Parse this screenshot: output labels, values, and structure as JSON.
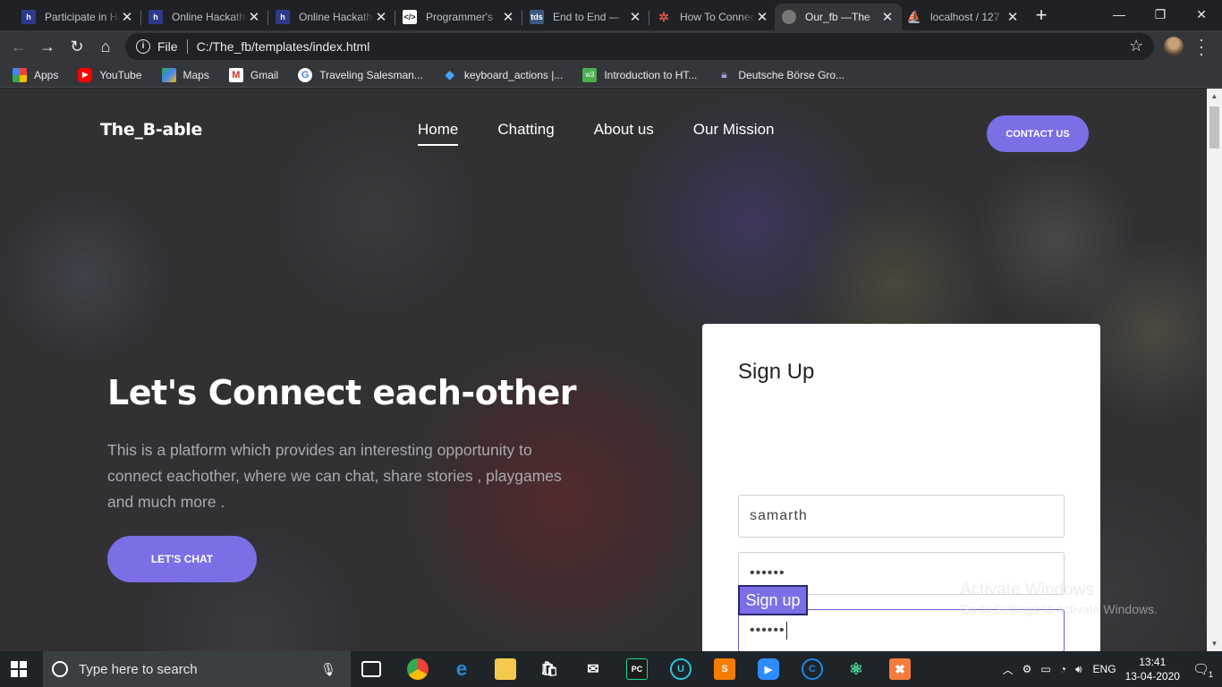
{
  "browser": {
    "tabs": [
      {
        "title": "Participate in HackerEarth",
        "favicon": "hackerearth-icon",
        "color": "#2d3a8c"
      },
      {
        "title": "Online Hackathons",
        "favicon": "hackerearth-icon",
        "color": "#2d3a8c"
      },
      {
        "title": "Online Hackathons",
        "favicon": "hackerearth-icon",
        "color": "#2d3a8c"
      },
      {
        "title": "Programmer's",
        "favicon": "code-icon",
        "color": "#444"
      },
      {
        "title": "End to End — ",
        "favicon": "tds-icon",
        "color": "#3d5a80"
      },
      {
        "title": "How To Connect",
        "favicon": "gear-icon",
        "color": "#d9534f"
      },
      {
        "title": "Our_fb —The",
        "favicon": "globe-icon",
        "color": "#777"
      },
      {
        "title": "localhost / 127",
        "favicon": "phpmyadmin-icon",
        "color": "#e67e22"
      }
    ],
    "active_tab_index": 6,
    "address": {
      "scheme": "File",
      "path": "C:/The_fb/templates/index.html"
    },
    "bookmarks": [
      {
        "label": "Apps",
        "icon": "apps-grid-icon",
        "color": "#ea4335"
      },
      {
        "label": "YouTube",
        "icon": "youtube-icon",
        "color": "#ff0000"
      },
      {
        "label": "Maps",
        "icon": "maps-icon",
        "color": "#34a853"
      },
      {
        "label": "Gmail",
        "icon": "gmail-icon",
        "color": "#d93025"
      },
      {
        "label": "Traveling Salesman...",
        "icon": "google-icon",
        "color": "#4285f4"
      },
      {
        "label": "keyboard_actions |...",
        "icon": "flutter-icon",
        "color": "#42a5f5"
      },
      {
        "label": "Introduction to HT...",
        "icon": "w3-icon",
        "color": "#4caf50"
      },
      {
        "label": "Deutsche Börse Gro...",
        "icon": "lock-icon",
        "color": "#5c6bc0"
      }
    ]
  },
  "page": {
    "brand": "The_B-able",
    "nav": [
      "Home",
      "Chatting",
      "About us",
      "Our Mission"
    ],
    "active_nav": "Home",
    "contact_label": "CONTACT US",
    "hero_title": "Let's Connect each-other",
    "hero_text": "This is a platform which provides an interesting opportunity to connect eachother, where we can chat, share stories , playgames and much more .",
    "chat_label": "LET'S CHAT",
    "signup": {
      "title": "Sign Up",
      "username": "samarth",
      "password": "••••••",
      "confirm": "••••••",
      "button": "Sign up"
    },
    "accent": "#7a6fe6"
  },
  "watermark": {
    "line1": "Activate Windows",
    "line2": "Go to Settings to activate Windows."
  },
  "taskbar": {
    "search_placeholder": "Type here to search",
    "language": "ENG",
    "time": "13:41",
    "date": "13-04-2020",
    "notification_count": "1"
  }
}
